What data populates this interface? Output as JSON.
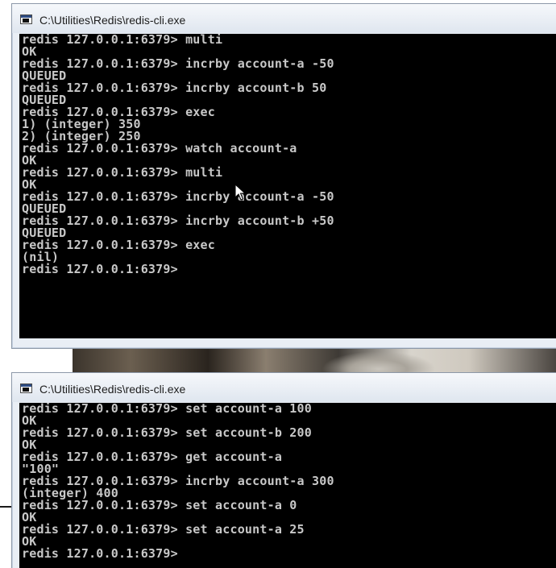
{
  "windows": [
    {
      "title": "C:\\Utilities\\Redis\\redis-cli.exe",
      "lines": [
        "redis 127.0.0.1:6379> multi",
        "OK",
        "redis 127.0.0.1:6379> incrby account-a -50",
        "QUEUED",
        "redis 127.0.0.1:6379> incrby account-b 50",
        "QUEUED",
        "redis 127.0.0.1:6379> exec",
        "1) (integer) 350",
        "2) (integer) 250",
        "redis 127.0.0.1:6379> watch account-a",
        "OK",
        "redis 127.0.0.1:6379> multi",
        "OK",
        "redis 127.0.0.1:6379> incrby account-a -50",
        "QUEUED",
        "redis 127.0.0.1:6379> incrby account-b +50",
        "QUEUED",
        "redis 127.0.0.1:6379> exec",
        "(nil)",
        "redis 127.0.0.1:6379>"
      ]
    },
    {
      "title": "C:\\Utilities\\Redis\\redis-cli.exe",
      "lines": [
        "redis 127.0.0.1:6379> set account-a 100",
        "OK",
        "redis 127.0.0.1:6379> set account-b 200",
        "OK",
        "redis 127.0.0.1:6379> get account-a",
        "\"100\"",
        "redis 127.0.0.1:6379> incrby account-a 300",
        "(integer) 400",
        "redis 127.0.0.1:6379> set account-a 0",
        "OK",
        "redis 127.0.0.1:6379> set account-a 25",
        "OK",
        "redis 127.0.0.1:6379>"
      ]
    }
  ],
  "icons": {
    "window_icon": "console-window-icon",
    "pointer": "mouse-pointer-icon"
  },
  "colors": {
    "console_bg": "#000000",
    "console_text": "#c8c8c8",
    "titlebar": "#e9eef5"
  }
}
